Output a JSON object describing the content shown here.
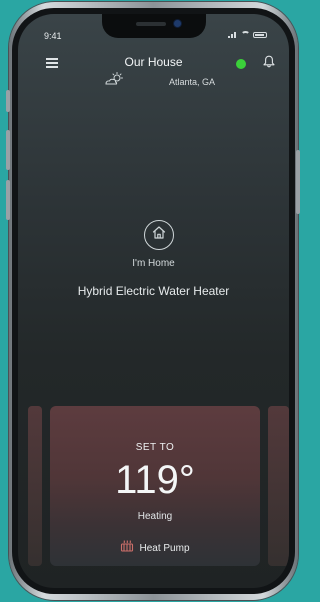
{
  "status_bar": {
    "time": "9:41"
  },
  "header": {
    "title": "Our House",
    "location": "Atlanta, GA",
    "menu_icon": "hamburger-menu-icon",
    "weather_icon": "partly-sunny-icon",
    "connection_status_color": "#3bd13a",
    "notifications_icon": "bell-icon"
  },
  "home_status": {
    "icon": "house-icon",
    "label": "I'm Home"
  },
  "device": {
    "name": "Hybrid Electric Water Heater"
  },
  "setpoint_card": {
    "set_to_label": "SET TO",
    "temperature": "119°",
    "status": "Heating",
    "mode_icon": "heat-pump-icon",
    "mode_label": "Heat Pump",
    "accent_color": "#5d3c3f"
  }
}
